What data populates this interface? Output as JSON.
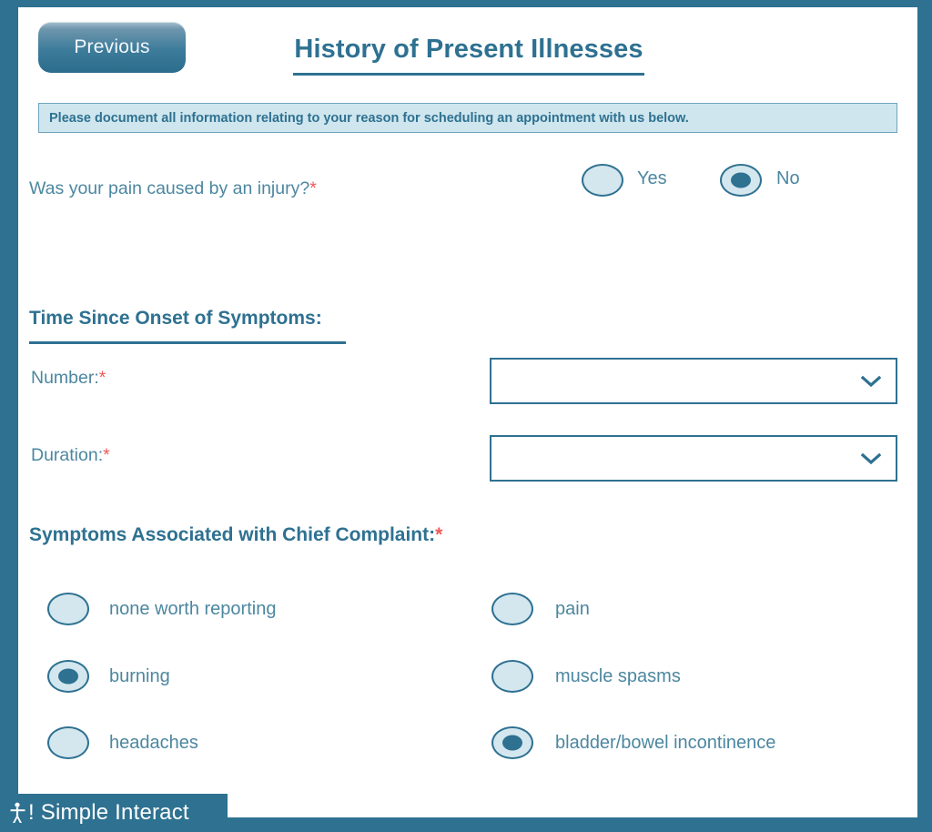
{
  "window": {
    "frame_color": "#2e7191",
    "page_background": "#ffffff"
  },
  "header": {
    "previous_button_label": "Previous",
    "title": "History of Present Illnesses"
  },
  "banner": {
    "text": "Please document all information relating to your reason for scheduling an appointment with us below.",
    "background": "#cfe6ee",
    "border_color": "#6fa5bd",
    "text_color": "#2e7191"
  },
  "injury_question": {
    "label": "Was your pain caused by an injury?",
    "required_marker": "*",
    "options": [
      {
        "label": "Yes",
        "selected": false
      },
      {
        "label": "No",
        "selected": true
      }
    ]
  },
  "onset_section": {
    "heading": "Time Since Onset of Symptoms:",
    "fields": [
      {
        "label": "Number:",
        "required_marker": "*",
        "value": "",
        "placeholder": "",
        "icon": "chevron-down-icon"
      },
      {
        "label": "Duration:",
        "required_marker": "*",
        "value": "",
        "placeholder": "",
        "icon": "chevron-down-icon"
      }
    ]
  },
  "symptoms_section": {
    "heading": "Symptoms Associated with Chief Complaint:",
    "required_marker": "*",
    "left_options": [
      {
        "label": "none worth reporting",
        "selected": false
      },
      {
        "label": "burning",
        "selected": true
      },
      {
        "label": "headaches",
        "selected": false
      }
    ],
    "right_options": [
      {
        "label": "pain",
        "selected": false
      },
      {
        "label": "muscle spasms",
        "selected": false
      },
      {
        "label": "bladder/bowel incontinence",
        "selected": true
      }
    ]
  },
  "footer": {
    "logo_icon": "person-figure-icon",
    "logo_text": "! Simple Interact",
    "background": "#2e7191",
    "text_color": "#ffffff"
  },
  "colors": {
    "accent": "#2e7191",
    "label_text": "#4c87a0",
    "required": "#ef5a5a",
    "radio_fill": "#d4e7ef"
  }
}
